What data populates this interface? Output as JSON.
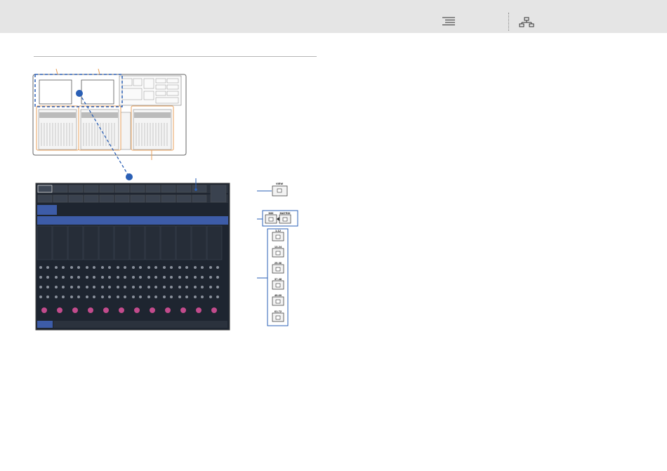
{
  "toolbar": {
    "toc_icon": "table-of-contents-icon",
    "tree_icon": "site-map-icon"
  },
  "colors": {
    "topbar": "#e5e5e5",
    "callout_orange": "#e8a15c",
    "callout_blue": "#2a5fb5",
    "dark_panel": "#1e2530",
    "fader_pink": "#c24b8c"
  },
  "panel": {
    "bank_tabs_row1": [
      "CH1-12",
      "CH13-24",
      "CH25-36",
      "CH37-48",
      "CH49-60",
      "CH61-72",
      "CH73-84",
      "CH85-96",
      "CH97-108",
      "CH109-120",
      "ST IN 1-12",
      "ST IN 13-24"
    ],
    "bank_tabs_row2": [
      "MIX 1-12",
      "MIX 13-24",
      "MIX 25-36",
      "MIX 37-48",
      "MIX 49-60",
      "MIX 61-72",
      "MATRIX 1-12",
      "MATRIX 13-24",
      "MATRIX 25-36",
      "DCA 1-12",
      "DCA 13-24",
      "ST"
    ],
    "strip_names": [
      "ch 1",
      "ch 2",
      "ch 3",
      "ch 4",
      "ch 5",
      "ch 6",
      "ch 7",
      "ch 8",
      "ch 9",
      "ch 10",
      "ch 11",
      "ch 12"
    ]
  },
  "buttons": {
    "view": "VIEW",
    "mix": "MIX",
    "matrix": "MATRIX",
    "banks": [
      "1-12",
      "13-24",
      "25-36",
      "37-48",
      "49-60",
      "61-72"
    ]
  }
}
